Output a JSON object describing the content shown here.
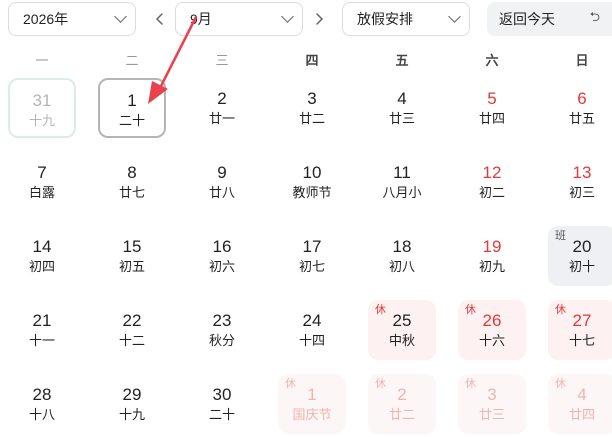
{
  "toolbar": {
    "year": "2026年",
    "month": "9月",
    "holiday_filter": "放假安排",
    "today_label": "返回今天",
    "today_icon": "return-arrow-icon",
    "prev_icon": "chevron-left-icon",
    "next_icon": "chevron-right-icon"
  },
  "weekdays": [
    "一",
    "二",
    "三",
    "四",
    "五",
    "六",
    "日"
  ],
  "badges": {
    "rest": "休",
    "work": "班"
  },
  "colors": {
    "holiday_red": "#e03a3a",
    "rest_bg": "#fdf1f1",
    "work_bg": "#eef0f3",
    "selected_border": "#b5b5b5",
    "annotation_arrow": "#e8434a"
  },
  "weeks": [
    [
      {
        "num": "31",
        "lunar": "十九",
        "state": "prev-month"
      },
      {
        "num": "1",
        "lunar": "二十",
        "state": "selected"
      },
      {
        "num": "2",
        "lunar": "廿一"
      },
      {
        "num": "3",
        "lunar": "廿二"
      },
      {
        "num": "4",
        "lunar": "廿三"
      },
      {
        "num": "5",
        "lunar": "廿四",
        "weekend": true
      },
      {
        "num": "6",
        "lunar": "廿五",
        "weekend": true
      }
    ],
    [
      {
        "num": "7",
        "lunar": "白露"
      },
      {
        "num": "8",
        "lunar": "廿七"
      },
      {
        "num": "9",
        "lunar": "廿八"
      },
      {
        "num": "10",
        "lunar": "教师节"
      },
      {
        "num": "11",
        "lunar": "八月小"
      },
      {
        "num": "12",
        "lunar": "初二",
        "weekend": true
      },
      {
        "num": "13",
        "lunar": "初三",
        "weekend": true
      }
    ],
    [
      {
        "num": "14",
        "lunar": "初四"
      },
      {
        "num": "15",
        "lunar": "初五"
      },
      {
        "num": "16",
        "lunar": "初六"
      },
      {
        "num": "17",
        "lunar": "初七"
      },
      {
        "num": "18",
        "lunar": "初八"
      },
      {
        "num": "19",
        "lunar": "初九",
        "weekend": true
      },
      {
        "num": "20",
        "lunar": "初十",
        "badge": "work"
      }
    ],
    [
      {
        "num": "21",
        "lunar": "十一"
      },
      {
        "num": "22",
        "lunar": "十二"
      },
      {
        "num": "23",
        "lunar": "秋分"
      },
      {
        "num": "24",
        "lunar": "十四"
      },
      {
        "num": "25",
        "lunar": "中秋",
        "badge": "rest"
      },
      {
        "num": "26",
        "lunar": "十六",
        "badge": "rest",
        "weekend": true
      },
      {
        "num": "27",
        "lunar": "十七",
        "badge": "rest",
        "weekend": true
      }
    ],
    [
      {
        "num": "28",
        "lunar": "十八"
      },
      {
        "num": "29",
        "lunar": "十九"
      },
      {
        "num": "30",
        "lunar": "二十"
      },
      {
        "num": "1",
        "lunar": "国庆节",
        "badge": "rest",
        "faded": true
      },
      {
        "num": "2",
        "lunar": "廿二",
        "badge": "rest",
        "faded": true
      },
      {
        "num": "3",
        "lunar": "廿三",
        "badge": "rest",
        "faded": true
      },
      {
        "num": "4",
        "lunar": "廿四",
        "badge": "rest",
        "faded": true
      }
    ]
  ]
}
